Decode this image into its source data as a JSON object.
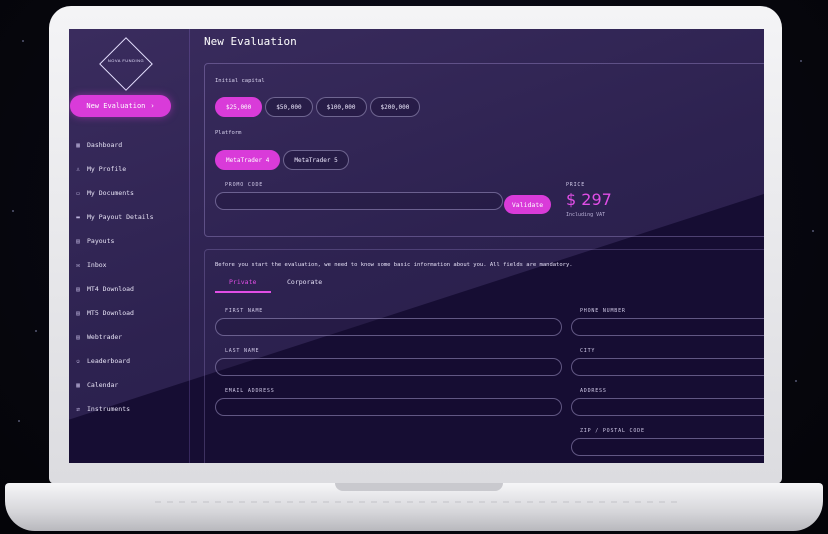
{
  "sidebar": {
    "logo_text": "NOVA FUNDING",
    "new_eval_label": "New Evaluation",
    "new_eval_chevron": "›",
    "items": [
      {
        "label": "Dashboard",
        "icon": "grid-icon",
        "glyph": "▦"
      },
      {
        "label": "My Profile",
        "icon": "user-icon",
        "glyph": "♙"
      },
      {
        "label": "My Documents",
        "icon": "document-icon",
        "glyph": "▭"
      },
      {
        "label": "My Payout Details",
        "icon": "card-icon",
        "glyph": "▬"
      },
      {
        "label": "Payouts",
        "icon": "payout-icon",
        "glyph": "▤"
      },
      {
        "label": "Inbox",
        "icon": "inbox-icon",
        "glyph": "✉"
      },
      {
        "label": "MT4 Download",
        "icon": "download-icon",
        "glyph": "▤"
      },
      {
        "label": "MT5 Download",
        "icon": "download-icon",
        "glyph": "▤"
      },
      {
        "label": "Webtrader",
        "icon": "browser-icon",
        "glyph": "▤"
      },
      {
        "label": "Leaderboard",
        "icon": "trophy-icon",
        "glyph": "♔"
      },
      {
        "label": "Calendar",
        "icon": "calendar-icon",
        "glyph": "▦"
      },
      {
        "label": "Instruments",
        "icon": "swap-icon",
        "glyph": "⇄"
      }
    ]
  },
  "main": {
    "title": "New Evaluation",
    "capital_label": "Initial capital",
    "capital_options": [
      "$25,000",
      "$50,000",
      "$100,000",
      "$200,000"
    ],
    "capital_selected": 0,
    "platform_label": "Platform",
    "platform_options": [
      "MetaTrader 4",
      "MetaTrader 5"
    ],
    "platform_selected": 0,
    "promo_label": "PROMO CODE",
    "promo_value": "",
    "validate_label": "Validate",
    "price_label": "PRICE",
    "price_value": "$ 297",
    "price_note": "Including VAT"
  },
  "form": {
    "intro": "Before you start the evaluation, we need to know some basic information about you. All fields are mandatory.",
    "tabs": [
      "Private",
      "Corporate"
    ],
    "active_tab": 0,
    "fields": {
      "first_name": "FIRST NAME",
      "last_name": "LAST NAME",
      "email": "EMAIL ADDRESS",
      "phone": "PHONE NUMBER",
      "city": "CITY",
      "address": "ADDRESS",
      "zip": "ZIP / POSTAL CODE"
    }
  },
  "colors": {
    "accent": "#d93bd9",
    "background": "#160d33"
  }
}
